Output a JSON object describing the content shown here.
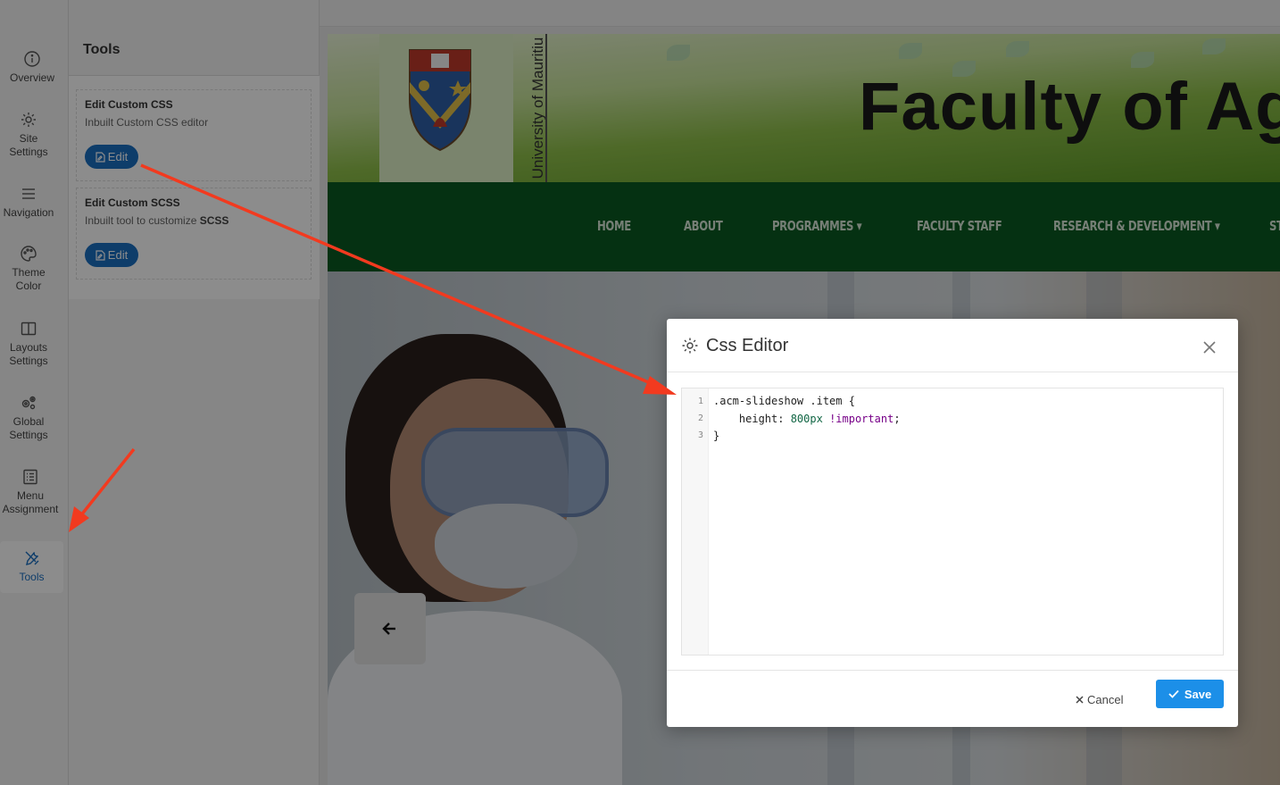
{
  "sidebar": {
    "items": [
      {
        "name": "overview",
        "label": "Overview",
        "icon": "info-circle-icon"
      },
      {
        "name": "site-settings",
        "label": "Site Settings",
        "icon": "gear-icon"
      },
      {
        "name": "navigation",
        "label": "Navigation",
        "icon": "menu-lines-icon"
      },
      {
        "name": "theme-color",
        "label": "Theme Color",
        "icon": "palette-icon"
      },
      {
        "name": "layouts-settings",
        "label": "Layouts Settings",
        "icon": "columns-icon"
      },
      {
        "name": "global-settings",
        "label": "Global Settings",
        "icon": "gears-icon"
      },
      {
        "name": "menu-assignment",
        "label": "Menu Assignment",
        "icon": "list-icon"
      },
      {
        "name": "tools",
        "label": "Tools",
        "icon": "tools-icon",
        "active": true
      }
    ],
    "active_color": "#1b6fc2"
  },
  "tools_panel": {
    "title": "Tools",
    "cards": [
      {
        "title": "Edit Custom CSS",
        "description": "Inbuilt Custom CSS editor",
        "button": "Edit"
      },
      {
        "title": "Edit Custom SCSS",
        "description_prefix": "Inbuilt tool to customize ",
        "description_bold": "SCSS",
        "button": "Edit"
      }
    ]
  },
  "site": {
    "university": "University of Mauritiu",
    "title": "Faculty of Ag",
    "nav": [
      "HOME",
      "ABOUT",
      "PROGRAMMES",
      "FACULTY STAFF",
      "RESEARCH & DEVELOPMENT",
      "ST"
    ],
    "nav_dropdown_mark": "▾",
    "nav_color": "#0a5a22"
  },
  "modal": {
    "title": "Css Editor",
    "line_numbers": [
      "1",
      "2",
      "3"
    ],
    "code": {
      "line1": ".acm-slideshow .item {",
      "line2_prop": "    height: ",
      "line2_value": "800px",
      "line2_important": "!important",
      "line2_end": ";",
      "line3": "}"
    },
    "cancel_label": "Cancel",
    "save_label": "Save",
    "save_color": "#1c8fe8"
  },
  "annotation": {
    "arrow_color": "#f23a1f"
  }
}
